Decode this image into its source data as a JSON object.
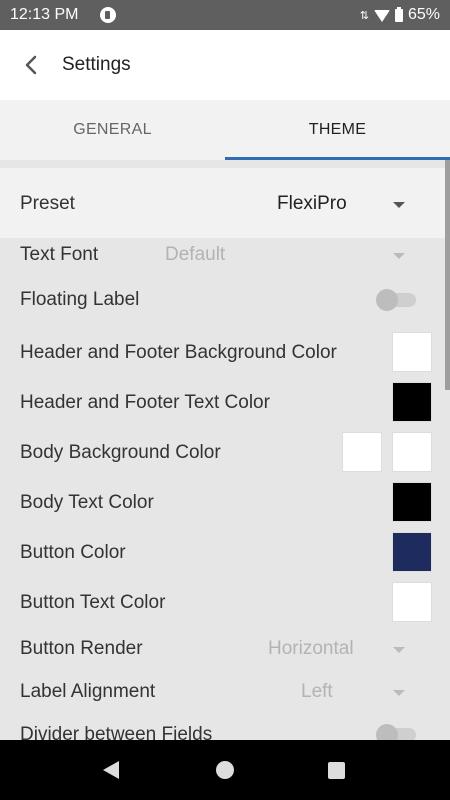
{
  "status_bar": {
    "time": "12:13 PM",
    "battery": "65%",
    "icons": [
      "app-notification-icon",
      "data-arrows-icon",
      "wifi-icon",
      "battery-icon"
    ]
  },
  "header": {
    "title": "Settings",
    "back_icon": "chevron-left-icon"
  },
  "tabs": [
    {
      "label": "GENERAL",
      "selected": false
    },
    {
      "label": "THEME",
      "selected": true
    }
  ],
  "theme": {
    "preset": {
      "label": "Preset",
      "value": "FlexiPro"
    },
    "text_font": {
      "label": "Text Font",
      "value": "Default"
    },
    "floating_label": {
      "label": "Floating Label",
      "on": false
    },
    "header_footer_bg": {
      "label": "Header and Footer Background Color",
      "color": "#ffffff"
    },
    "header_footer_text": {
      "label": "Header and Footer Text Color",
      "color": "#000000"
    },
    "body_bg": {
      "label": "Body Background Color",
      "colors": [
        "#ffffff",
        "#ffffff"
      ]
    },
    "body_text": {
      "label": "Body Text Color",
      "color": "#000000"
    },
    "button_color": {
      "label": "Button Color",
      "color": "#1e2b5e"
    },
    "button_text": {
      "label": "Button Text Color",
      "color": "#ffffff"
    },
    "button_render": {
      "label": "Button Render",
      "value": "Horizontal"
    },
    "label_alignment": {
      "label": "Label Alignment",
      "value": "Left"
    },
    "divider": {
      "label": "Divider between Fields",
      "on": false
    }
  },
  "colors": {
    "accent": "#2f6cb2",
    "header_bg": "#ffffff",
    "content_bg": "#e6e6e6"
  },
  "nav_bar": {
    "icons": [
      "back-triangle-icon",
      "home-circle-icon",
      "recents-square-icon"
    ]
  }
}
